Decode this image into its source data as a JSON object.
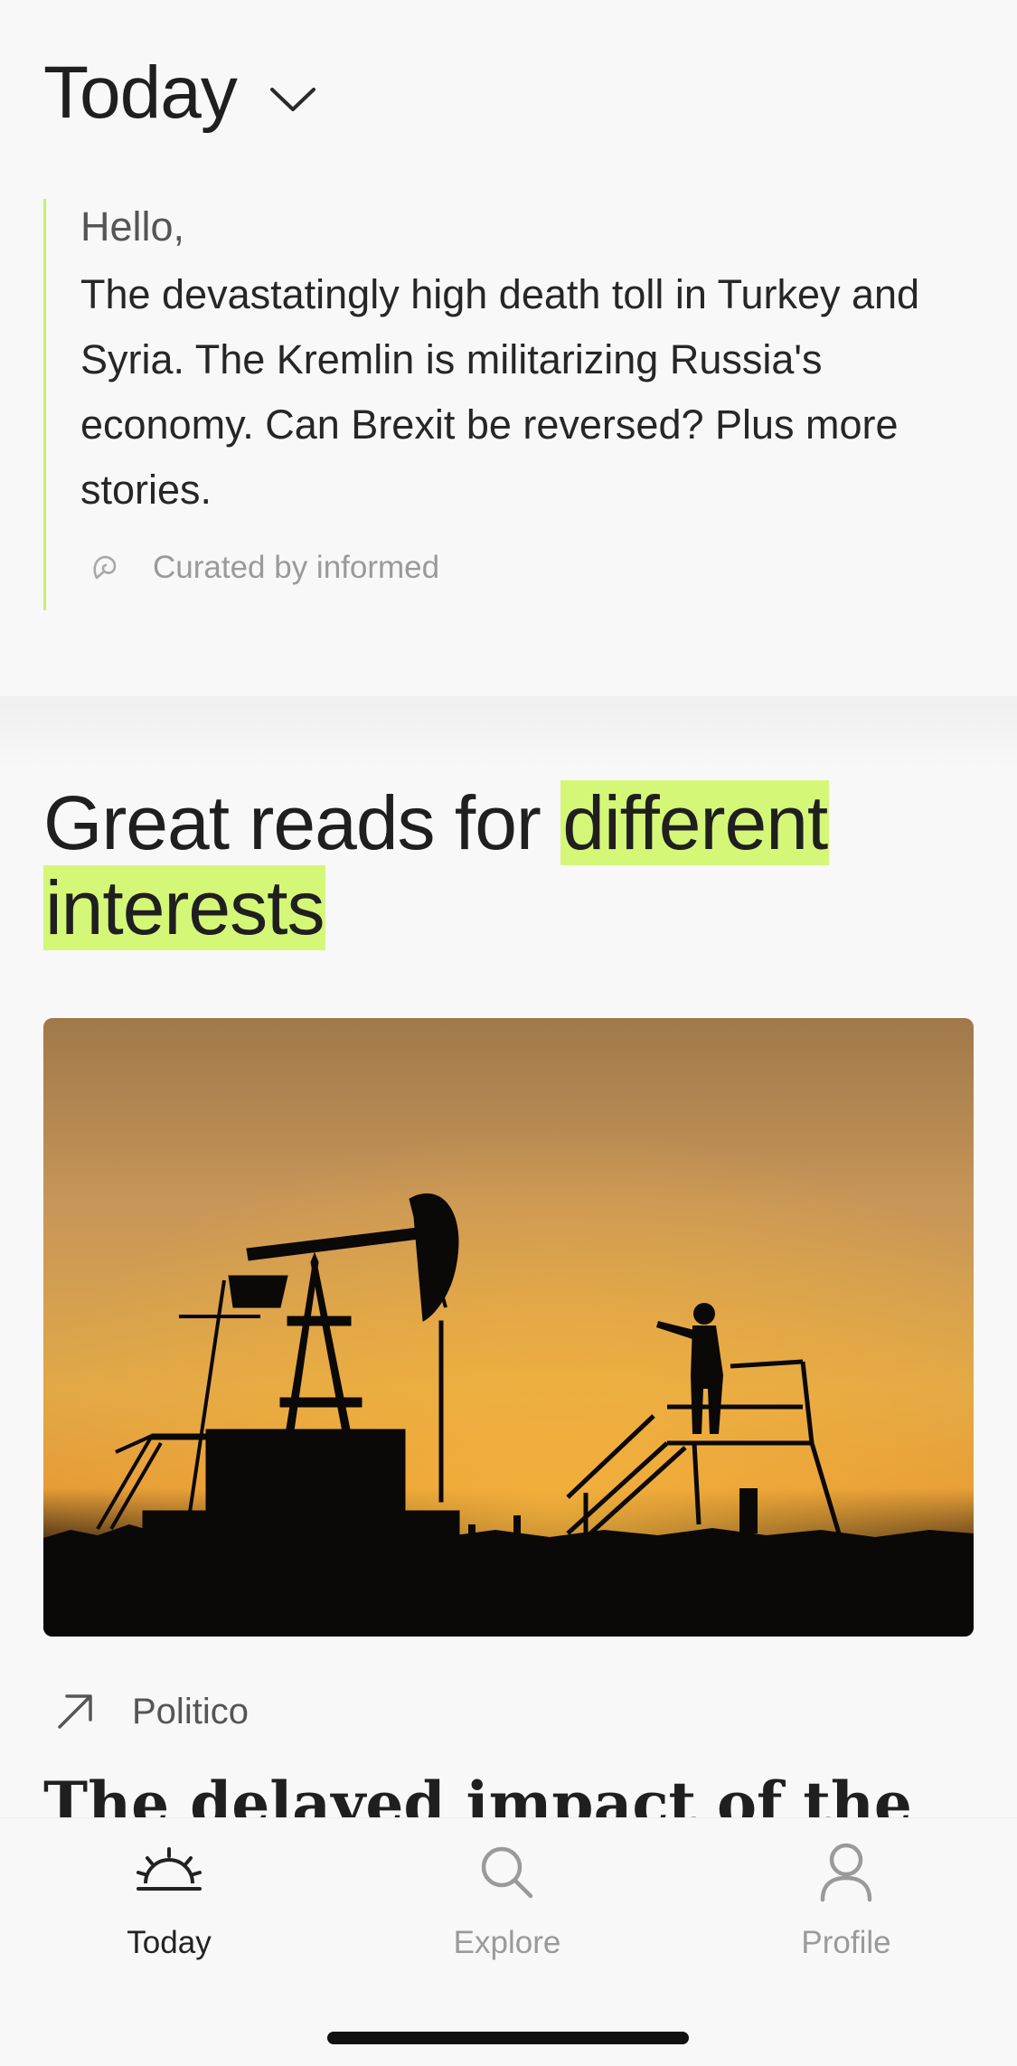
{
  "header": {
    "title": "Today",
    "chevron_icon": "chevron-down-icon"
  },
  "intro": {
    "greeting": "Hello,",
    "summary": "The devastatingly high death toll in Turkey and Syria. The Kremlin is militarizing Russia's economy. Can Brexit be reversed? Plus more stories.",
    "curated_icon": "informed-logo-icon",
    "curated_by": "Curated by informed"
  },
  "section": {
    "heading_plain": "Great reads for ",
    "heading_highlight_1": "different",
    "heading_highlight_2": "interests",
    "highlight_color": "#d5f778"
  },
  "article": {
    "image_description_icon": "oil-pumpjack-sunset-image",
    "source_icon": "external-arrow-icon",
    "source": "Politico",
    "title_partial": "The delayed impact of the"
  },
  "bottom_nav": {
    "items": [
      {
        "label": "Today",
        "icon": "sunrise-icon",
        "active": true
      },
      {
        "label": "Explore",
        "icon": "search-icon",
        "active": false
      },
      {
        "label": "Profile",
        "icon": "person-icon",
        "active": false
      }
    ]
  },
  "colors": {
    "accent": "#c6f16d",
    "background": "#f8f8f8",
    "text": "#222222",
    "muted": "#9a9a9a"
  }
}
